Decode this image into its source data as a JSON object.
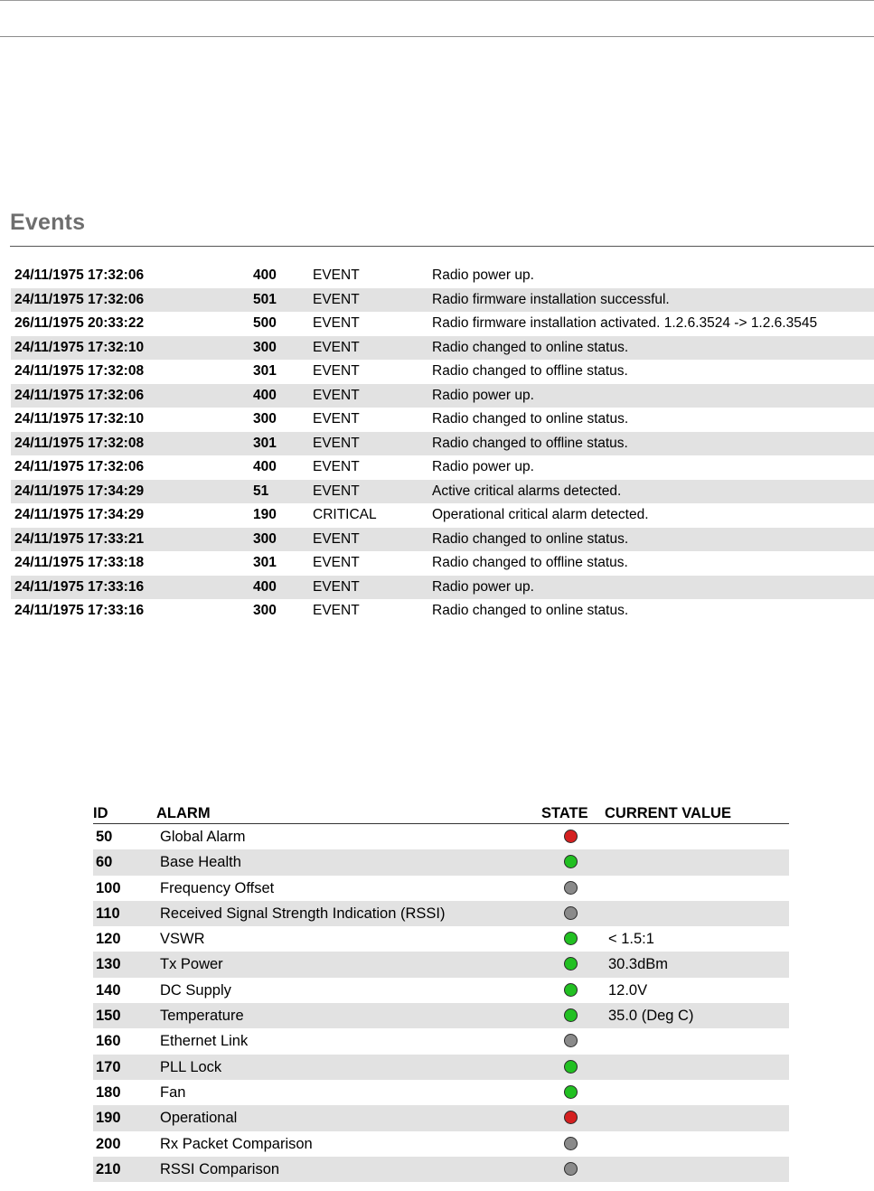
{
  "events": {
    "title": "Events",
    "rows": [
      {
        "time": "24/11/1975 17:32:06",
        "code": "400",
        "type": "EVENT",
        "message": "Radio power up."
      },
      {
        "time": "24/11/1975 17:32:06",
        "code": "501",
        "type": "EVENT",
        "message": "Radio firmware installation successful."
      },
      {
        "time": "26/11/1975 20:33:22",
        "code": "500",
        "type": "EVENT",
        "message": "Radio firmware installation activated. 1.2.6.3524 -> 1.2.6.3545"
      },
      {
        "time": "24/11/1975 17:32:10",
        "code": "300",
        "type": "EVENT",
        "message": "Radio changed to online status."
      },
      {
        "time": "24/11/1975 17:32:08",
        "code": "301",
        "type": "EVENT",
        "message": "Radio changed to offline status."
      },
      {
        "time": "24/11/1975 17:32:06",
        "code": "400",
        "type": "EVENT",
        "message": "Radio power up."
      },
      {
        "time": "24/11/1975 17:32:10",
        "code": "300",
        "type": "EVENT",
        "message": "Radio changed to online status."
      },
      {
        "time": "24/11/1975 17:32:08",
        "code": "301",
        "type": "EVENT",
        "message": "Radio changed to offline status."
      },
      {
        "time": "24/11/1975 17:32:06",
        "code": "400",
        "type": "EVENT",
        "message": "Radio power up."
      },
      {
        "time": "24/11/1975 17:34:29",
        "code": "51",
        "type": "EVENT",
        "message": "Active critical alarms detected."
      },
      {
        "time": "24/11/1975 17:34:29",
        "code": "190",
        "type": "CRITICAL",
        "message": "Operational critical alarm detected."
      },
      {
        "time": "24/11/1975 17:33:21",
        "code": "300",
        "type": "EVENT",
        "message": "Radio changed to online status."
      },
      {
        "time": "24/11/1975 17:33:18",
        "code": "301",
        "type": "EVENT",
        "message": "Radio changed to offline status."
      },
      {
        "time": "24/11/1975 17:33:16",
        "code": "400",
        "type": "EVENT",
        "message": "Radio power up."
      },
      {
        "time": "24/11/1975 17:33:16",
        "code": "300",
        "type": "EVENT",
        "message": "Radio changed to online status."
      }
    ]
  },
  "alarms": {
    "headers": {
      "id": "ID",
      "alarm": "ALARM",
      "state": "STATE",
      "current_value": "CURRENT VALUE"
    },
    "state_colors": {
      "red": "#d42020",
      "green": "#22c022",
      "grey": "#8a8a8a"
    },
    "rows": [
      {
        "id": "50",
        "name": "Global Alarm",
        "state": "red",
        "value": ""
      },
      {
        "id": "60",
        "name": "Base Health",
        "state": "green",
        "value": ""
      },
      {
        "id": "100",
        "name": "Frequency Offset",
        "state": "grey",
        "value": ""
      },
      {
        "id": "110",
        "name": "Received Signal Strength Indication (RSSI)",
        "state": "grey",
        "value": ""
      },
      {
        "id": "120",
        "name": "VSWR",
        "state": "green",
        "value": "< 1.5:1"
      },
      {
        "id": "130",
        "name": "Tx Power",
        "state": "green",
        "value": "30.3dBm"
      },
      {
        "id": "140",
        "name": "DC Supply",
        "state": "green",
        "value": "12.0V"
      },
      {
        "id": "150",
        "name": "Temperature",
        "state": "green",
        "value": "35.0 (Deg C)"
      },
      {
        "id": "160",
        "name": "Ethernet Link",
        "state": "grey",
        "value": ""
      },
      {
        "id": "170",
        "name": "PLL Lock",
        "state": "green",
        "value": ""
      },
      {
        "id": "180",
        "name": "Fan",
        "state": "green",
        "value": ""
      },
      {
        "id": "190",
        "name": "Operational",
        "state": "red",
        "value": ""
      },
      {
        "id": "200",
        "name": "Rx Packet Comparison",
        "state": "grey",
        "value": ""
      },
      {
        "id": "210",
        "name": "RSSI Comparison",
        "state": "grey",
        "value": ""
      }
    ]
  }
}
